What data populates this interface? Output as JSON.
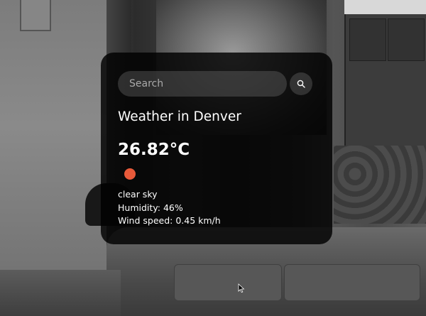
{
  "search": {
    "placeholder": "Search",
    "value": "",
    "button_icon": "search-icon"
  },
  "weather": {
    "title": "Weather in Denver",
    "temperature": "26.82°C",
    "icon": "sun-icon",
    "icon_color": "#e85a3a",
    "description": "clear sky",
    "humidity": "Humidity: 46%",
    "wind": "Wind speed: 0.45 km/h"
  },
  "colors": {
    "card_background": "#000000",
    "text": "#ffffff",
    "input_background": "#7c7c7c"
  }
}
